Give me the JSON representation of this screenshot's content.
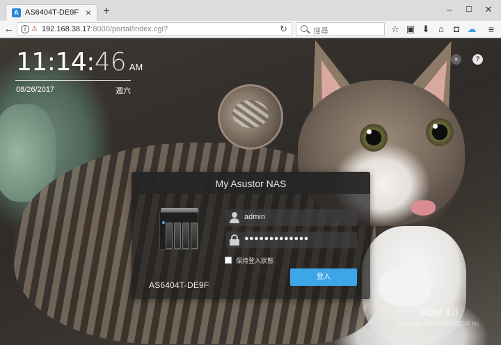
{
  "browser": {
    "tab_title": "AS6404T-DE9F",
    "tab_favicon": "A",
    "tab_close": "×",
    "new_tab": "+",
    "window_controls": {
      "minimize": "–",
      "maximize": "☐",
      "close": "✕"
    },
    "url_host": "192.168.38.17",
    "url_rest": ":8000/portal/index.cgi?",
    "search_placeholder": "搜尋",
    "toolbar_icons": [
      "bookmark-star-icon",
      "reading-list-icon",
      "download-icon",
      "home-icon",
      "pocket-icon",
      "cloud-icon",
      "menu-icon"
    ]
  },
  "clock": {
    "hours_minutes": "11:14:",
    "seconds": "46",
    "ampm": "AM",
    "date": "08/26/2017",
    "weekday": "週六"
  },
  "login": {
    "title": "My Asustor NAS",
    "device_name": "AS6404T-DE9F",
    "username": "admin",
    "password_mask": "●●●●●●●●●●●●●",
    "remember_label": "保持登入狀態",
    "remember_checked": false,
    "login_button": "登入"
  },
  "footer": {
    "version": "ADM 3.0",
    "copyright": "Copyright © 2017 ASUSTOR Inc."
  },
  "colors": {
    "accent": "#3da6e9",
    "panel": "#1e1e1e"
  }
}
